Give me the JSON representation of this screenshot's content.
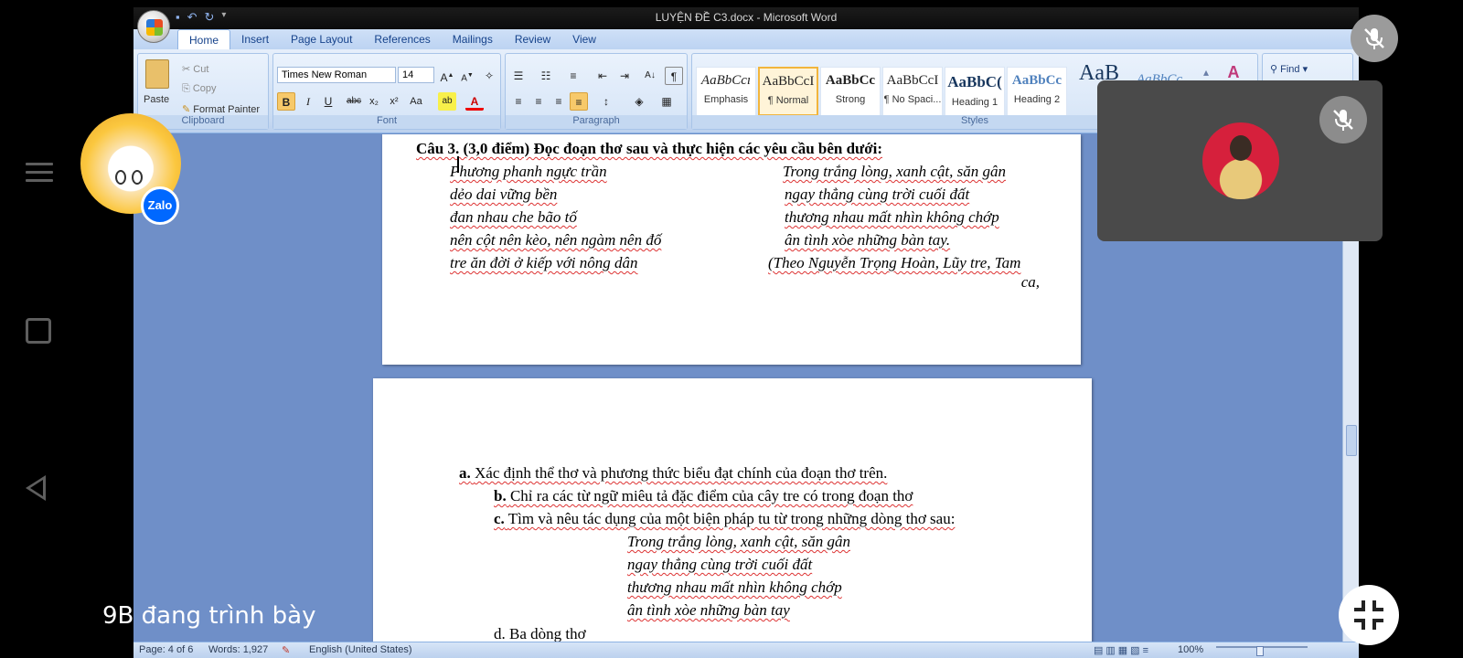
{
  "word": {
    "title": "LUYỆN ĐỀ C3.docx - Microsoft Word",
    "tabs": [
      "Home",
      "Insert",
      "Page Layout",
      "References",
      "Mailings",
      "Review",
      "View"
    ],
    "clipboard": {
      "paste": "Paste",
      "cut": "Cut",
      "copy": "Copy",
      "format_painter": "Format Painter",
      "label": "Clipboard"
    },
    "font": {
      "name": "Times New Roman",
      "size": "14",
      "label": "Font"
    },
    "paragraph": {
      "label": "Paragraph"
    },
    "styles": {
      "label": "Styles",
      "items": [
        {
          "preview": "AaBbCcı",
          "name": "Emphasis"
        },
        {
          "preview": "AaBbCcI",
          "name": "¶ Normal"
        },
        {
          "preview": "AaBbCc",
          "name": "Strong"
        },
        {
          "preview": "AaBbCcI",
          "name": "¶ No Spaci..."
        },
        {
          "preview": "AaBbC(",
          "name": "Heading 1"
        },
        {
          "preview": "AaBbCc",
          "name": "Heading 2"
        }
      ],
      "more_preview_1": "AaB",
      "more_preview_2": "AaBbCc"
    },
    "find": "Find",
    "document": {
      "question": "Câu 3. (3,0 điểm) Đọc đoạn thơ sau và thực hiện các yêu cầu bên dưới:",
      "poem_left": [
        "Phương phanh ngực trần",
        "dẻo dai vững bền",
        "đan nhau che bão tố",
        "nên cột nên kèo, nên ngàm nên đố",
        "tre ăn đời ở kiếp với nông dân"
      ],
      "poem_right": [
        "Trong trắng lòng,  xanh cật, săn gân",
        "ngay thẳng cùng trời cuối đất",
        "thương nhau mất nhìn không chớp",
        "ân tình xòe những bàn tay."
      ],
      "source_line1": "(Theo Nguyễn Trọng Hoàn, Lũy tre, Tam",
      "source_line2": "ca,",
      "items": [
        {
          "marker": "a.",
          "text": "Xác định thể thơ và phương thức biểu đạt chính của đoạn thơ trên."
        },
        {
          "marker": "b.",
          "text": "Chỉ ra các từ ngữ miêu tả đặc điểm của cây tre có trong đoạn thơ"
        },
        {
          "marker": "c.",
          "text": "Tìm và nêu tác dụng của một biện pháp tu từ trong những dòng thơ sau:"
        }
      ],
      "quote": [
        "Trong trắng lòng,  xanh cật, săn gân",
        "ngay thẳng cùng trời cuối đất",
        "thương nhau mất nhìn không chớp",
        "ân tình xòe những bàn tay"
      ],
      "cut_line": "d. Ba dòng thơ"
    },
    "status": {
      "page": "Page: 4 of 6",
      "words": "Words: 1,927",
      "language": "English (United States)",
      "zoom": "100%"
    }
  },
  "overlay": {
    "zalo": "Zalo",
    "presenting": "9B đang trình bày"
  }
}
